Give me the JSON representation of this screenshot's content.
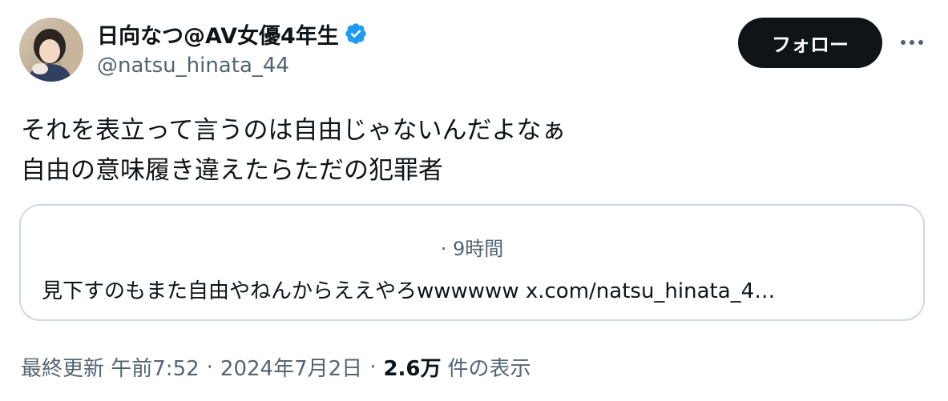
{
  "author": {
    "display_name": "日向なつ@AV女優4年生",
    "handle": "@natsu_hinata_44",
    "verified": true,
    "verified_color": "#1d9bf0"
  },
  "actions": {
    "follow_label": "フォロー",
    "more_icon": "ellipsis-icon"
  },
  "tweet": {
    "lines": [
      "それを表立って言うのは自由じゃないんだよなぁ",
      "自由の意味履き違えたらただの犯罪者"
    ]
  },
  "quoted_tweet": {
    "time": "· 9時間",
    "text": "見下すのもまた自由やねんからええやろwwwwww x.com/natsu_hinata_4…"
  },
  "footer": {
    "edited_time": "最終更新 午前7:52",
    "separator": "·",
    "date": "2024年7月2日",
    "views_count": "2.6万",
    "views_label": "件の表示"
  }
}
